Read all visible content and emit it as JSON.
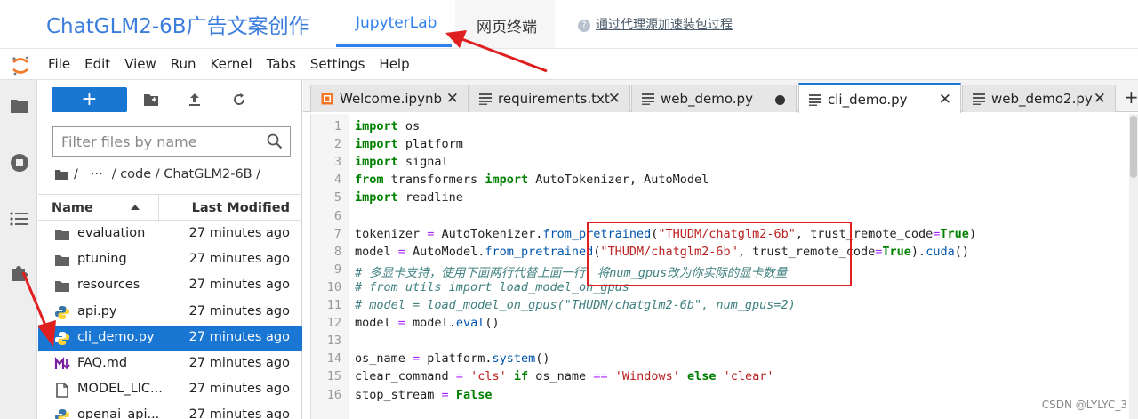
{
  "header": {
    "app_title": "ChatGLM2-6B广告文案创作",
    "tabs": [
      {
        "label": "JupyterLab",
        "active": true
      },
      {
        "label": "网页终端",
        "active": false
      }
    ],
    "proxy_link": "通过代理源加速装包过程"
  },
  "menu": [
    "File",
    "Edit",
    "View",
    "Run",
    "Kernel",
    "Tabs",
    "Settings",
    "Help"
  ],
  "sidebar_icons": [
    "folder-icon",
    "running-icon",
    "toc-icon",
    "extension-icon"
  ],
  "file_browser": {
    "new_label": "+",
    "filter_placeholder": "Filter files by name",
    "breadcrumb": [
      "/",
      "···",
      "/ code / ChatGLM2-6B /"
    ],
    "columns": {
      "name": "Name",
      "modified": "Last Modified"
    },
    "files": [
      {
        "name": "evaluation",
        "modified": "27 minutes ago",
        "icon": "folder-icon"
      },
      {
        "name": "ptuning",
        "modified": "27 minutes ago",
        "icon": "folder-icon"
      },
      {
        "name": "resources",
        "modified": "27 minutes ago",
        "icon": "folder-icon"
      },
      {
        "name": "api.py",
        "modified": "27 minutes ago",
        "icon": "python-icon"
      },
      {
        "name": "cli_demo.py",
        "modified": "27 minutes ago",
        "icon": "python-icon",
        "selected": true
      },
      {
        "name": "FAQ.md",
        "modified": "27 minutes ago",
        "icon": "markdown-icon"
      },
      {
        "name": "MODEL_LIC...",
        "modified": "27 minutes ago",
        "icon": "file-icon"
      },
      {
        "name": "openai_api...",
        "modified": "27 minutes ago",
        "icon": "python-icon"
      }
    ]
  },
  "editor": {
    "tabs": [
      {
        "label": "Welcome.ipynb",
        "icon": "notebook-icon",
        "control": "close"
      },
      {
        "label": "requirements.txt",
        "icon": "text-file-icon",
        "control": "close"
      },
      {
        "label": "web_demo.py",
        "icon": "text-file-icon",
        "control": "unsaved-dot"
      },
      {
        "label": "cli_demo.py",
        "icon": "text-file-icon",
        "control": "close",
        "active": true
      },
      {
        "label": "web_demo2.py",
        "icon": "text-file-icon",
        "control": "close"
      }
    ],
    "add_tab_label": "+",
    "code_lines": [
      {
        "n": "1",
        "text": "import os"
      },
      {
        "n": "2",
        "text": "import platform"
      },
      {
        "n": "3",
        "text": "import signal"
      },
      {
        "n": "4",
        "text": "from transformers import AutoTokenizer, AutoModel"
      },
      {
        "n": "5",
        "text": "import readline"
      },
      {
        "n": "6",
        "text": ""
      },
      {
        "n": "7",
        "text": "tokenizer = AutoTokenizer.from_pretrained(\"THUDM/chatglm2-6b\", trust_remote_code=True)"
      },
      {
        "n": "8",
        "text": "model = AutoModel.from_pretrained(\"THUDM/chatglm2-6b\", trust_remote_code=True).cuda()"
      },
      {
        "n": "9",
        "text": "# 多显卡支持，使用下面两行代替上面一行，将num_gpus改为你实际的显卡数量"
      },
      {
        "n": "10",
        "text": "# from utils import load_model_on_gpus"
      },
      {
        "n": "11",
        "text": "# model = load_model_on_gpus(\"THUDM/chatglm2-6b\", num_gpus=2)"
      },
      {
        "n": "12",
        "text": "model = model.eval()"
      },
      {
        "n": "13",
        "text": ""
      },
      {
        "n": "14",
        "text": "os_name = platform.system()"
      },
      {
        "n": "15",
        "text": "clear_command = 'cls' if os_name == 'Windows' else 'clear'"
      },
      {
        "n": "16",
        "text": "stop_stream = False"
      }
    ]
  },
  "watermark": "CSDN @LYLYC_3",
  "colors": {
    "accent": "#1976d2",
    "annotation": "#e02020",
    "title_blue": "#3b7ddd"
  }
}
